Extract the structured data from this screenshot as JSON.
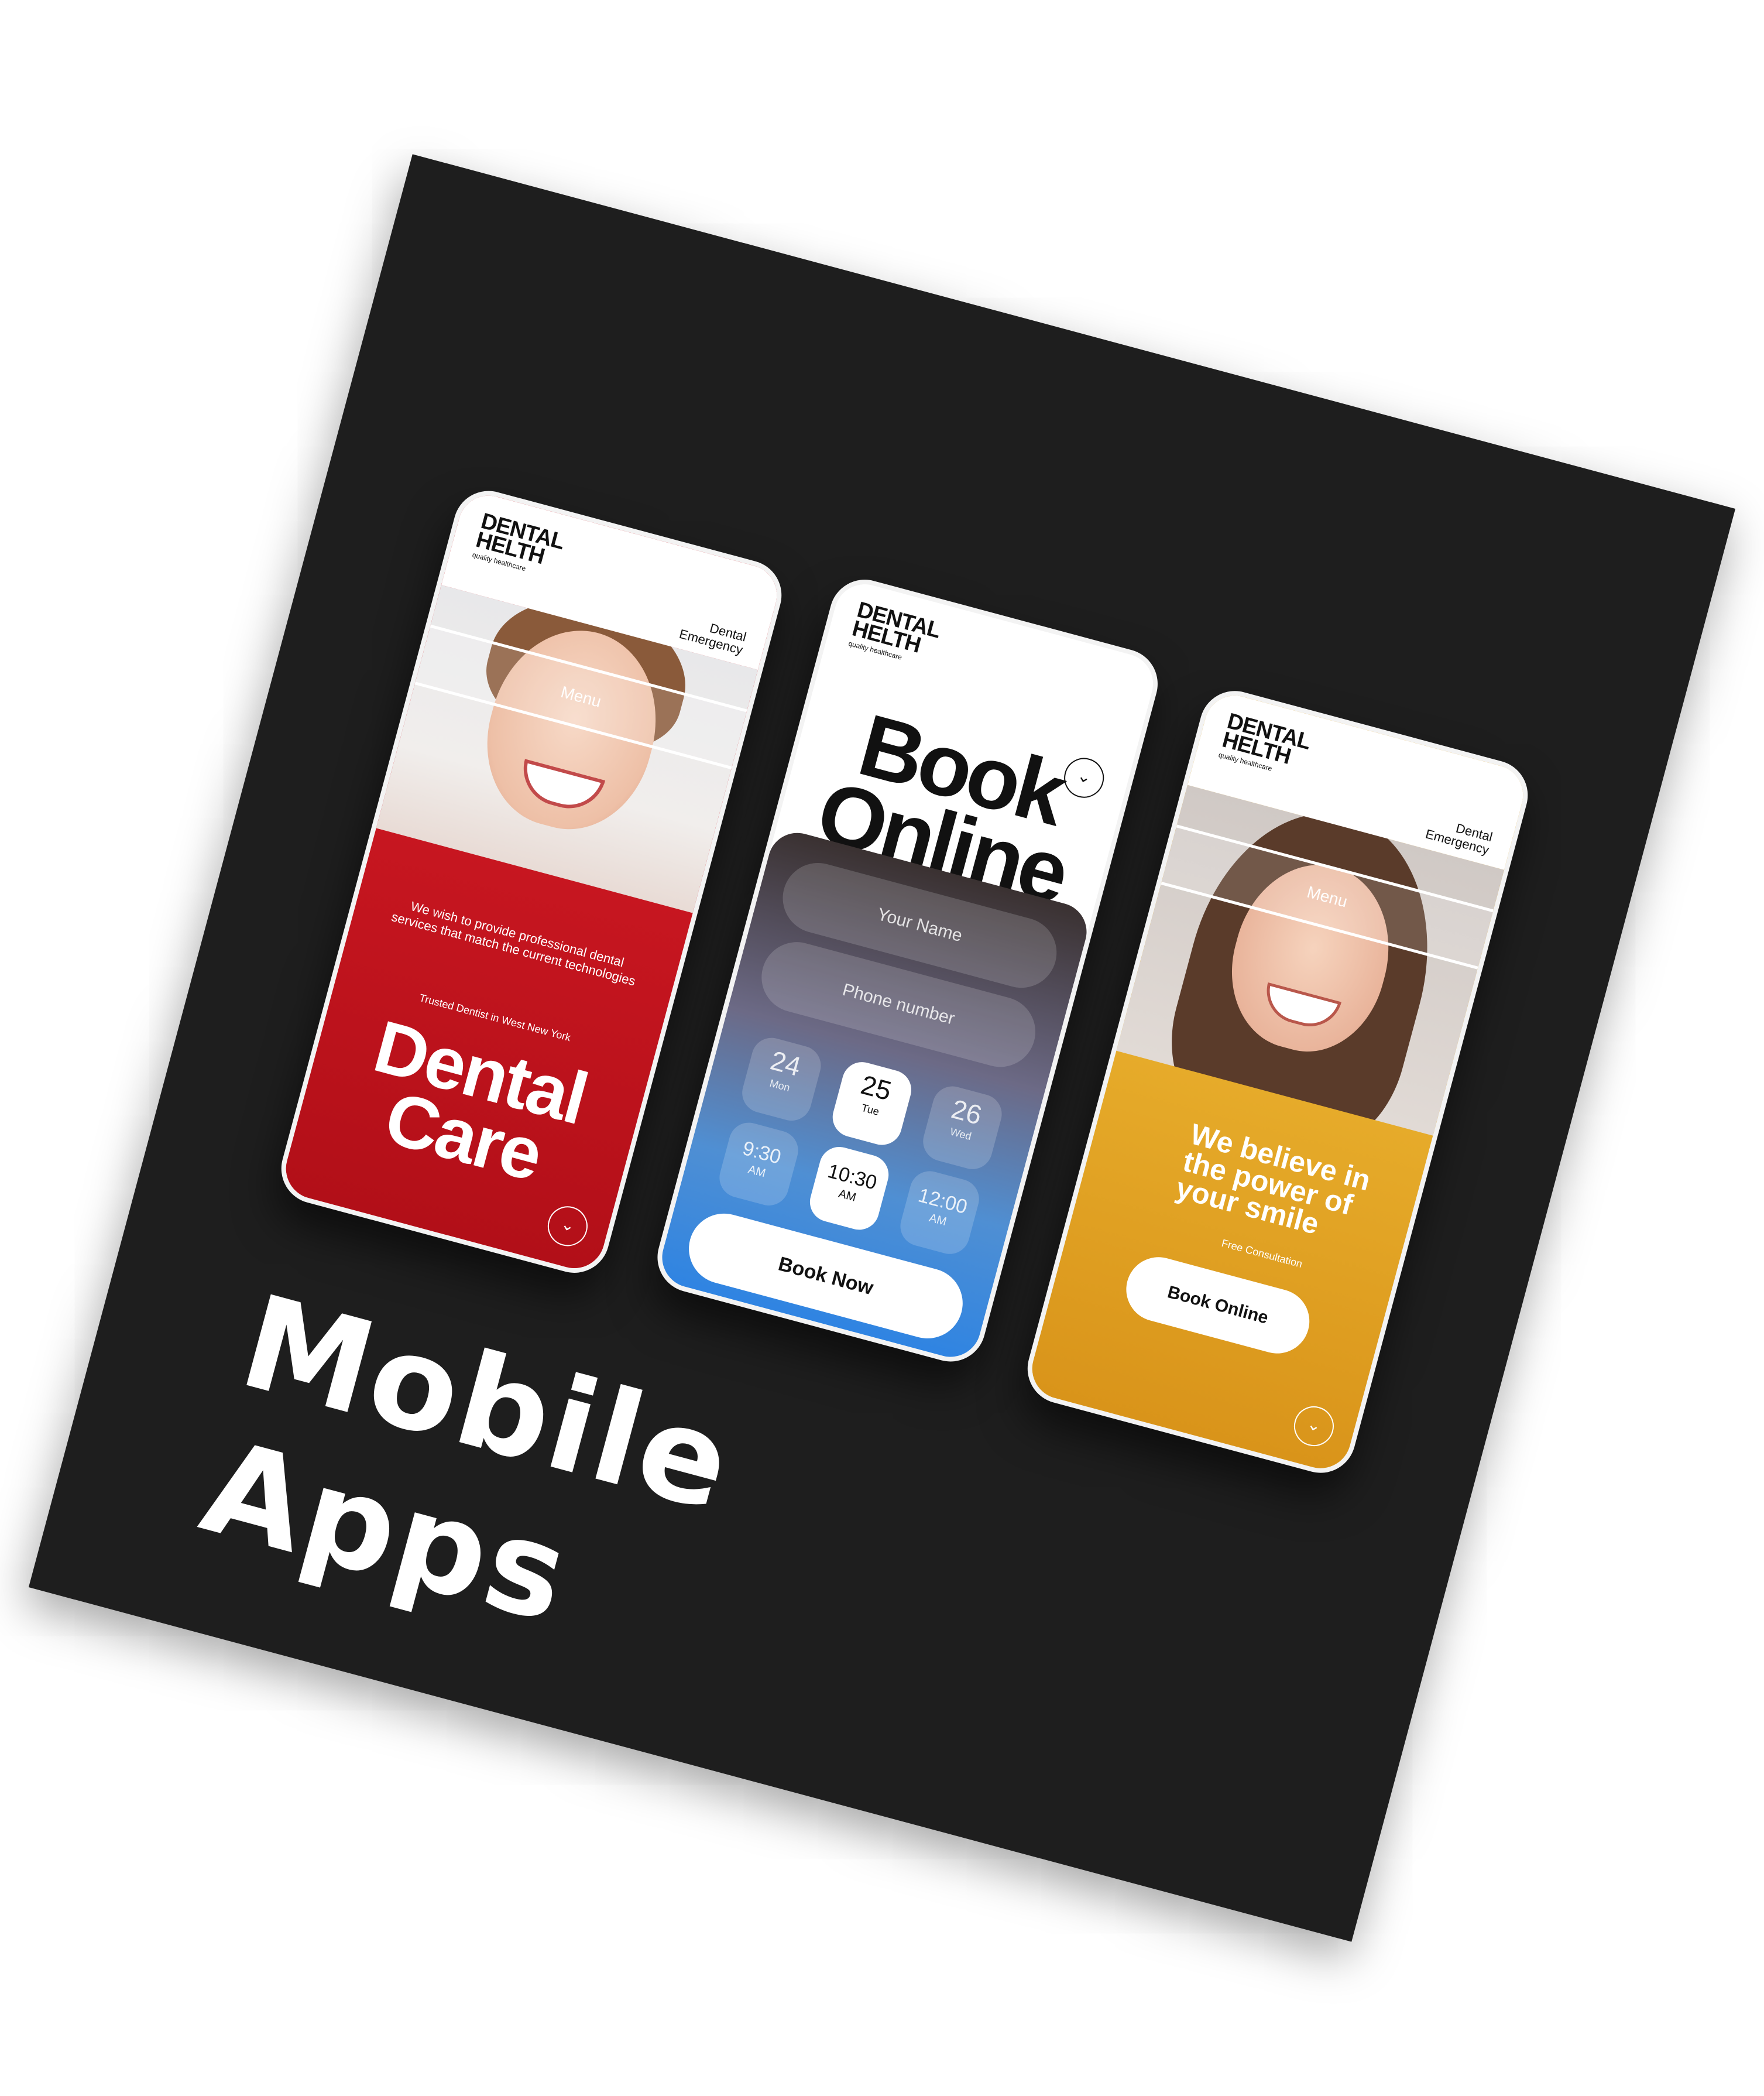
{
  "brand": {
    "line1": "DENTAL",
    "line2": "HELTH",
    "tagline": "quality healthcare"
  },
  "screens": [
    {
      "emergency": "Dental Emergency",
      "menu": "Menu",
      "mission": "We wish to provide professional dental services that match the current technologies",
      "trusted": "Trusted Dentist in West New York",
      "title_line1": "Dental",
      "title_line2": "Care",
      "scroll_icon": "chevron-down-icon"
    },
    {
      "title_line1": "Book",
      "title_line2": "Online",
      "name_placeholder": "Your Name",
      "phone_placeholder": "Phone number",
      "dates": [
        {
          "day": "24",
          "weekday": "Mon"
        },
        {
          "day": "25",
          "weekday": "Tue",
          "selected": true
        },
        {
          "day": "26",
          "weekday": "Wed"
        }
      ],
      "times": [
        {
          "value": "9:30",
          "ampm": "AM"
        },
        {
          "value": "10:30",
          "ampm": "AM",
          "selected": true
        },
        {
          "value": "12:00",
          "ampm": "AM"
        }
      ],
      "button": "Book Now",
      "scroll_icon": "chevron-down-icon"
    },
    {
      "emergency": "Dental Emergency",
      "menu": "Menu",
      "title": "We believe in the power of your smile",
      "free": "Free Consultation",
      "button": "Book Online",
      "scroll_icon": "chevron-down-icon"
    }
  ],
  "caption": "Mobile Apps",
  "colors": {
    "background": "#1e1e1e",
    "red": "#c8111c",
    "blue": "#2f84e2",
    "yellow": "#e1a424"
  }
}
